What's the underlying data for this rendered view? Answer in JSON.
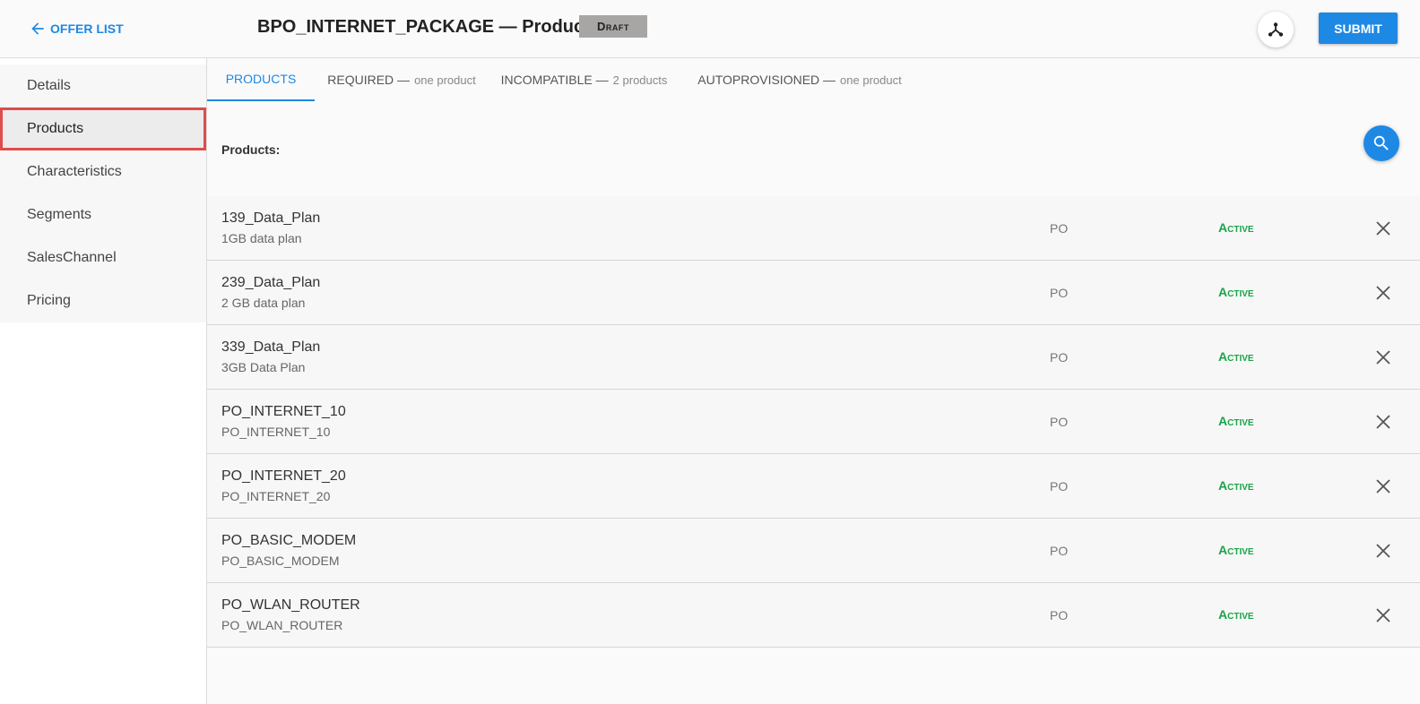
{
  "header": {
    "back_label": "OFFER LIST",
    "title": "BPO_INTERNET_PACKAGE — Products",
    "status": "Draft",
    "submit_label": "SUBMIT"
  },
  "sidebar": {
    "items": [
      {
        "label": "Details"
      },
      {
        "label": "Products"
      },
      {
        "label": "Characteristics"
      },
      {
        "label": "Segments"
      },
      {
        "label": "SalesChannel"
      },
      {
        "label": "Pricing"
      }
    ]
  },
  "tabs": [
    {
      "label": "PRODUCTS",
      "sub": ""
    },
    {
      "label": "REQUIRED —",
      "sub": "one product"
    },
    {
      "label": "INCOMPATIBLE —",
      "sub": "2 products"
    },
    {
      "label": "AUTOPROVISIONED —",
      "sub": "one product"
    }
  ],
  "section_label": "Products:",
  "products": [
    {
      "name": "139_Data_Plan",
      "desc": "1GB data plan",
      "type": "PO",
      "status": "Active"
    },
    {
      "name": "239_Data_Plan",
      "desc": "2 GB data plan",
      "type": "PO",
      "status": "Active"
    },
    {
      "name": "339_Data_Plan",
      "desc": "3GB Data Plan",
      "type": "PO",
      "status": "Active"
    },
    {
      "name": "PO_INTERNET_10",
      "desc": "PO_INTERNET_10",
      "type": "PO",
      "status": "Active"
    },
    {
      "name": "PO_INTERNET_20",
      "desc": "PO_INTERNET_20",
      "type": "PO",
      "status": "Active"
    },
    {
      "name": "PO_BASIC_MODEM",
      "desc": "PO_BASIC_MODEM",
      "type": "PO",
      "status": "Active"
    },
    {
      "name": "PO_WLAN_ROUTER",
      "desc": "PO_WLAN_ROUTER",
      "type": "PO",
      "status": "Active"
    }
  ],
  "colors": {
    "accent": "#1e88e5",
    "status_active": "#1aa34a",
    "draft_badge": "#a8a6a4",
    "selected_outline": "#e04b4b"
  },
  "icons": {
    "back": "arrow-left-icon",
    "hierarchy": "hierarchy-icon",
    "search": "search-icon",
    "remove": "close-icon"
  }
}
